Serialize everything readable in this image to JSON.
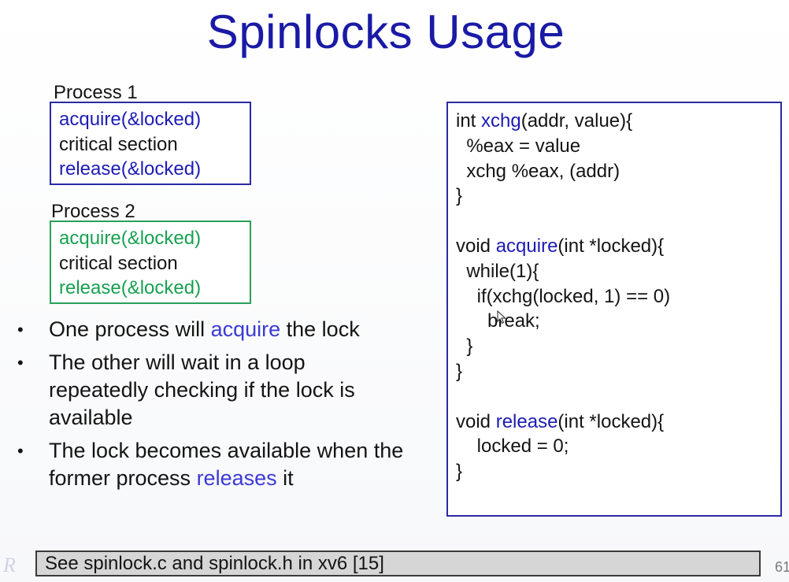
{
  "slide": {
    "title": "Spinlocks Usage",
    "page_number": "61"
  },
  "process1": {
    "label": "Process 1",
    "lines": [
      "acquire(&locked)",
      "critical section",
      "release(&locked)"
    ]
  },
  "process2": {
    "label": "Process 2",
    "lines": [
      "acquire(&locked)",
      "critical section",
      "release(&locked)"
    ]
  },
  "bullets": [
    {
      "pre": "One process will ",
      "highlight": "acquire",
      "post": " the lock"
    },
    {
      "text": "The other will wait in a loop repeatedly checking if the lock is available"
    },
    {
      "pre": "The lock becomes available when the former process ",
      "highlight": "releases",
      "post": " it"
    }
  ],
  "code": {
    "lines": [
      {
        "pre": "int ",
        "kw": "xchg",
        "post": "(addr, value){"
      },
      {
        "pre": "  %eax = value"
      },
      {
        "pre": "  xchg %eax, (addr)"
      },
      {
        "pre": "}"
      },
      {
        "pre": ""
      },
      {
        "pre": "void ",
        "kw": "acquire",
        "post": "(int *locked){"
      },
      {
        "pre": "  while(1){"
      },
      {
        "pre": "    if(xchg(locked, 1) == 0)"
      },
      {
        "pre": "      break;"
      },
      {
        "pre": "  }"
      },
      {
        "pre": "}"
      },
      {
        "pre": ""
      },
      {
        "pre": "void ",
        "kw": "release",
        "post": "(int *locked){"
      },
      {
        "pre": "    locked = 0;"
      },
      {
        "pre": "}"
      }
    ]
  },
  "footer": {
    "text": "See spinlock.c and spinlock.h in xv6 [15]"
  },
  "icons": {
    "watermark": "watermark-logo-icon",
    "cursor": "mouse-cursor-icon",
    "bullet": "•"
  },
  "colors": {
    "title": "#1a1aa6",
    "process1_border": "#2a2aa6",
    "process2_border": "#2aa05a",
    "blue_text": "#1c1cb4",
    "green_text": "#18a050",
    "highlight": "#3a3ad6",
    "footer_bg": "#d6d6d6"
  }
}
